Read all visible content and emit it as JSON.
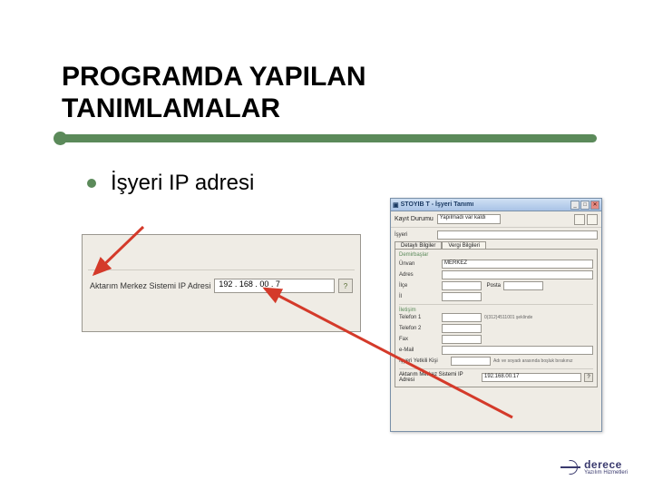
{
  "title_line1": "PROGRAMDA YAPILAN",
  "title_line2": "TANIMLAMALAR",
  "bullet": "İşyeri IP adresi",
  "left_panel": {
    "label": "Aktarım Merkez Sistemi IP Adresi",
    "value": "192 . 168 . 00 . 7",
    "btn": "?"
  },
  "dialog": {
    "title": "STOYIB T - İşyeri Tanımı",
    "toolbar": {
      "label": "Kayıt Durumu",
      "value": "Yapılmadı var kaldı"
    },
    "header": {
      "isyeri_label": "İşyeri",
      "isyeri_value": ""
    },
    "tabs": [
      "Detaylı Bilgiler",
      "Vergi Bilgileri"
    ],
    "group_title": "Demirbaşlar",
    "fields": {
      "unvan_label": "Ünvan",
      "unvan_value": "MERKEZ",
      "adres_label": "Adres",
      "adres_value": "",
      "ilce_label": "İlçe",
      "ilce_value": "",
      "posta_label": "Posta",
      "posta_value": "",
      "il_label": "İl",
      "il_value": "",
      "iletisim_title": "İletişim",
      "tel1_label": "Telefon 1",
      "tel1_value": "",
      "tel1_hint": "0(312)4511001 şeklinde",
      "tel2_label": "Telefon 2",
      "tel2_value": "",
      "fax_label": "Fax",
      "fax_value": "",
      "email_label": "e-Mail",
      "email_value": "",
      "resp_label": "İşyeri Yetkili Kişi",
      "resp_value": "",
      "resp_hint": "Adı ve soyadı arasında boşluk bırakınız",
      "ip_label": "Aktarım Merkez Sistemi IP Adresi",
      "ip_value": "192.168.00.17",
      "ip_btn": "?"
    }
  },
  "logo": {
    "name": "derece",
    "sub": "Yazılım Hizmetleri"
  }
}
